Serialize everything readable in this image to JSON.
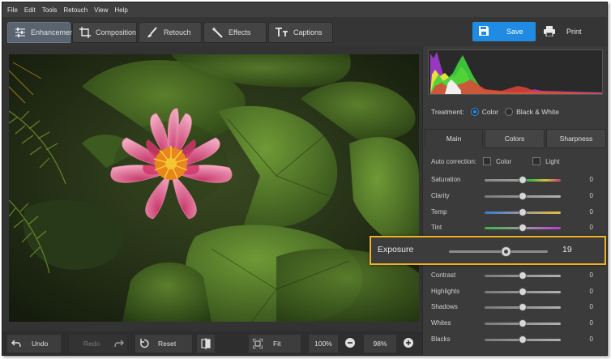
{
  "menu": {
    "items": [
      "File",
      "Edit",
      "Tools",
      "Retouch",
      "View",
      "Help"
    ]
  },
  "toolbar": {
    "tabs": [
      {
        "label": "Enhancement",
        "icon": "sliders-icon",
        "active": true
      },
      {
        "label": "Composition",
        "icon": "crop-icon",
        "active": false
      },
      {
        "label": "Retouch",
        "icon": "brush-icon",
        "active": false
      },
      {
        "label": "Effects",
        "icon": "magic-wand-icon",
        "active": false
      },
      {
        "label": "Captions",
        "icon": "text-icon",
        "active": false
      }
    ],
    "save_label": "Save",
    "print_label": "Print"
  },
  "bottom": {
    "undo_label": "Undo",
    "redo_label": "Redo",
    "reset_label": "Reset",
    "fit_label": "Fit",
    "zoom_100": "100%",
    "zoom_value": "98%"
  },
  "panel": {
    "treatment_label": "Treatment:",
    "treatment_color": "Color",
    "treatment_bw": "Black & White",
    "tabs": [
      "Main",
      "Colors",
      "Sharpness"
    ],
    "auto_label": "Auto correction:",
    "auto_color": "Color",
    "auto_light": "Light",
    "sliders": [
      {
        "name": "Saturation",
        "value": "0",
        "gradient": "sat"
      },
      {
        "name": "Clarity",
        "value": "0",
        "gradient": "gray"
      },
      {
        "name": "Temp",
        "value": "0",
        "gradient": "temp"
      },
      {
        "name": "Tint",
        "value": "0",
        "gradient": "tint"
      },
      {
        "name": "Contrast",
        "value": "0",
        "gradient": "gray"
      },
      {
        "name": "Highlights",
        "value": "0",
        "gradient": "gray"
      },
      {
        "name": "Shadows",
        "value": "0",
        "gradient": "gray"
      },
      {
        "name": "Whites",
        "value": "0",
        "gradient": "gray"
      },
      {
        "name": "Blacks",
        "value": "0",
        "gradient": "gray"
      }
    ],
    "exposure": {
      "name": "Exposure",
      "value": "19"
    }
  },
  "colors": {
    "accent": "#1f8be3",
    "highlight": "#f0b323"
  }
}
